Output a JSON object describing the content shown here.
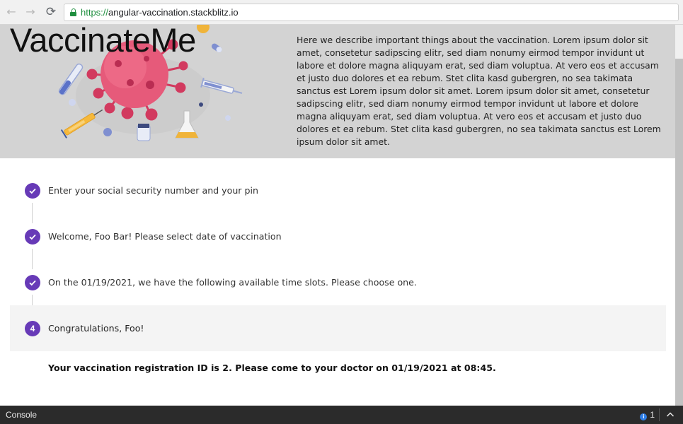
{
  "browser": {
    "url_scheme": "https://",
    "url_host": "angular-vaccination.stackblitz.io"
  },
  "hero": {
    "brand": "VaccinateMe",
    "description": "Here we describe important things about the vaccination. Lorem ipsum dolor sit amet, consetetur sadipscing elitr, sed diam nonumy eirmod tempor invidunt ut labore et dolore magna aliquyam erat, sed diam voluptua. At vero eos et accusam et justo duo dolores et ea rebum. Stet clita kasd gubergren, no sea takimata sanctus est Lorem ipsum dolor sit amet. Lorem ipsum dolor sit amet, consetetur sadipscing elitr, sed diam nonumy eirmod tempor invidunt ut labore et dolore magna aliquyam erat, sed diam voluptua. At vero eos et accusam et justo duo dolores et ea rebum. Stet clita kasd gubergren, no sea takimata sanctus est Lorem ipsum dolor sit amet."
  },
  "stepper": {
    "accent_color": "#673ab7",
    "steps": [
      {
        "label": "Enter your social security number and your pin",
        "state": "done"
      },
      {
        "label": "Welcome, Foo Bar! Please select date of vaccination",
        "state": "done"
      },
      {
        "label": "On the 01/19/2021, we have the following available time slots. Please choose one.",
        "state": "done"
      },
      {
        "label": "Congratulations, Foo!",
        "state": "active",
        "number": "4"
      }
    ],
    "result": "Your vaccination registration ID is 2. Please come to your doctor on 01/19/2021 at 08:45."
  },
  "console": {
    "label": "Console",
    "info_count": "1"
  }
}
